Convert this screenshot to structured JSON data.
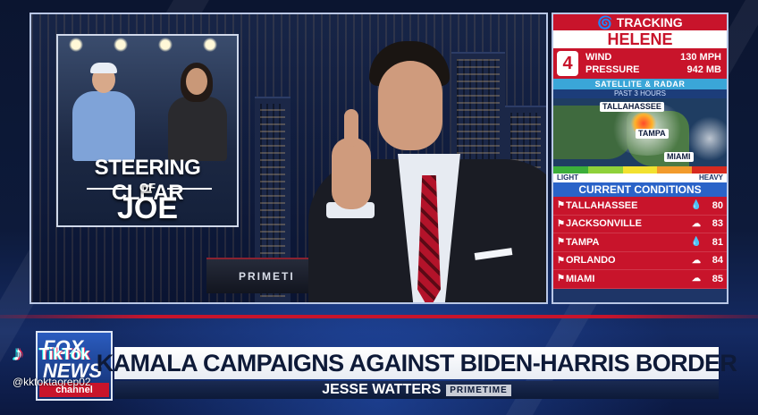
{
  "inset": {
    "line1": "STEERING CLEAR",
    "line2": "OF",
    "line3": "JOE"
  },
  "studio": {
    "wall_text": "PRIMETI"
  },
  "weather": {
    "header": "TRACKING",
    "storm_name": "HELENE",
    "category": "4",
    "wind_label": "WIND",
    "wind_value": "130 MPH",
    "pressure_label": "PRESSURE",
    "pressure_value": "942 MB",
    "satellite_label": "SATELLITE & RADAR",
    "past_label": "PAST 3 HOURS",
    "map_cities": [
      "TALLAHASSEE",
      "TAMPA",
      "MIAMI"
    ],
    "scale_light": "LIGHT",
    "scale_heavy": "HEAVY",
    "scale_colors": [
      "#3cae3a",
      "#8fd13a",
      "#f2e12f",
      "#f29b2c",
      "#d62a1f"
    ],
    "current_conditions_label": "CURRENT CONDITIONS",
    "conditions": [
      {
        "city": "TALLAHASSEE",
        "icon": "rain-drop-icon",
        "glyph": "💧",
        "temp": "80"
      },
      {
        "city": "JACKSONVILLE",
        "icon": "cloud-icon",
        "glyph": "☁",
        "temp": "83"
      },
      {
        "city": "TAMPA",
        "icon": "rain-drop-icon",
        "glyph": "💧",
        "temp": "81"
      },
      {
        "city": "ORLANDO",
        "icon": "cloud-icon",
        "glyph": "☁",
        "temp": "84"
      },
      {
        "city": "MIAMI",
        "icon": "cloud-icon",
        "glyph": "☁",
        "temp": "85"
      }
    ],
    "accent_red": "#c8142b",
    "accent_blue": "#2a63c8"
  },
  "network": {
    "logo_fox": "FOX",
    "logo_news": "NEWS",
    "logo_channel": "channel"
  },
  "chyron": {
    "headline": "KAMALA CAMPAIGNS AGAINST BIDEN-HARRIS BORDER",
    "show": "JESSE WATTERS",
    "show_badge": "PRIMETIME"
  },
  "watermark": {
    "brand": "TikTok",
    "handle": "@kktoktaorep02"
  }
}
